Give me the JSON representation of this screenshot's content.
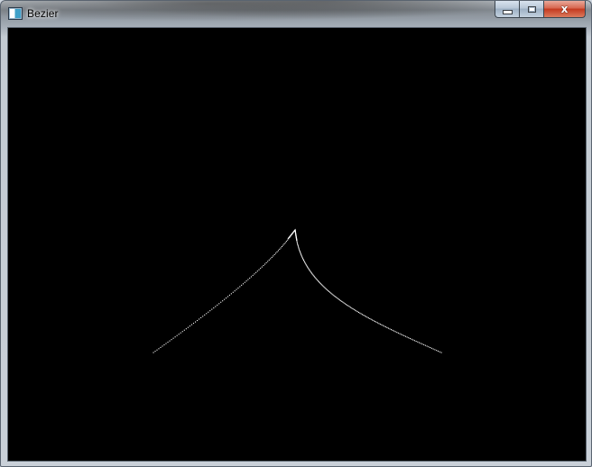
{
  "window": {
    "title": "Bezier",
    "app_icon": "app-window-icon",
    "controls": {
      "minimize_icon": "minimize-icon",
      "maximize_icon": "maximize-icon",
      "close_icon": "close-icon",
      "close_glyph": "x"
    }
  },
  "canvas": {
    "background": "#000000",
    "stroke_color": "#ffffff",
    "curve_style": "dotted-points"
  }
}
